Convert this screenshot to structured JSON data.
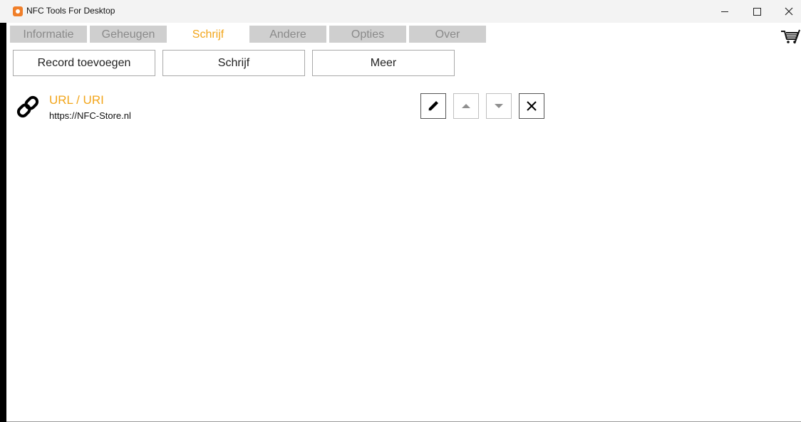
{
  "window": {
    "title": "NFC Tools For Desktop"
  },
  "tabs": [
    {
      "label": "Informatie",
      "active": false
    },
    {
      "label": "Geheugen",
      "active": false
    },
    {
      "label": "Schrijf",
      "active": true
    },
    {
      "label": "Andere",
      "active": false
    },
    {
      "label": "Opties",
      "active": false
    },
    {
      "label": "Over",
      "active": false
    }
  ],
  "toolbar": {
    "add_record_label": "Record toevoegen",
    "write_label": "Schrijf",
    "more_label": "Meer"
  },
  "records": [
    {
      "type_label": "URL / URI",
      "value": "https://NFC-Store.nl",
      "icon": "link-icon"
    }
  ],
  "colors": {
    "accent": "#f2a51a",
    "tab_inactive": "#cfcfcf",
    "app_icon": "#f07f2a"
  }
}
